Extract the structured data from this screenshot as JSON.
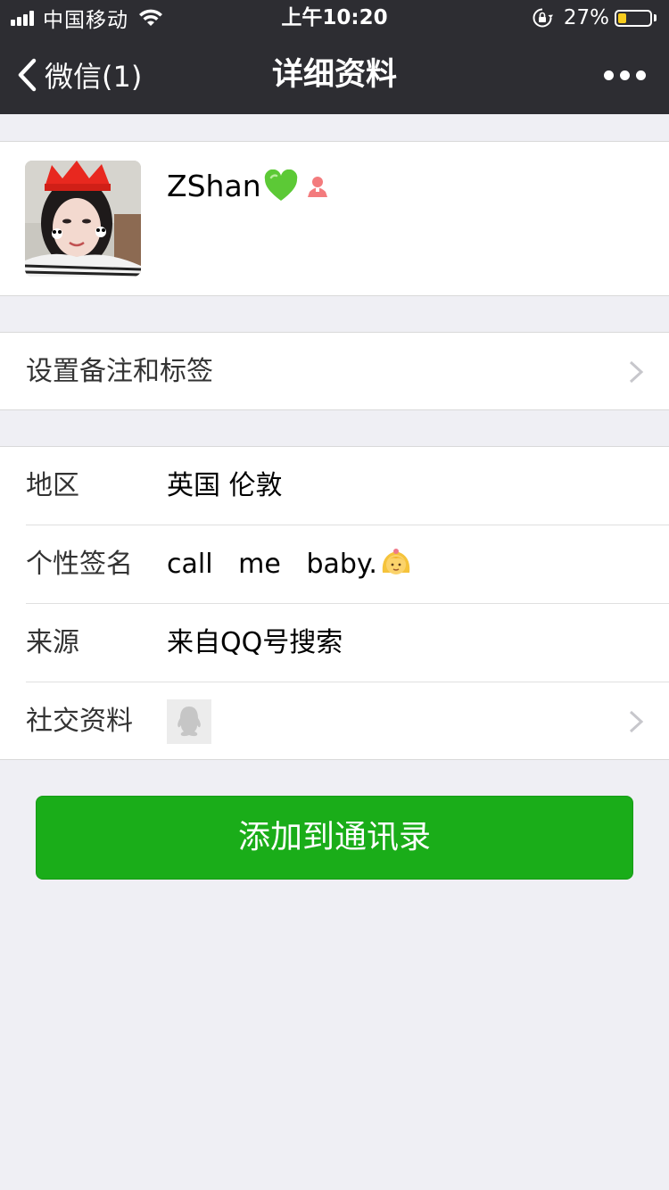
{
  "status_bar": {
    "carrier": "中国移动",
    "time": "上午10:20",
    "battery_percent_text": "27%",
    "battery_level": 0.27,
    "battery_color": "#f7cc1d"
  },
  "nav": {
    "back_label": "微信(1)",
    "title": "详细资料",
    "more_icon": "more-dots-icon"
  },
  "profile": {
    "name": "ZShan",
    "name_emoji": "green-heart-icon",
    "gender_icon": "female-icon",
    "gender_color": "#f37b7d"
  },
  "remark_row": {
    "label": "设置备注和标签"
  },
  "info_rows": {
    "region": {
      "label": "地区",
      "value": "英国 伦敦"
    },
    "signature": {
      "label": "个性签名",
      "value": "call   me   baby."
    },
    "source": {
      "label": "来源",
      "value": "来自QQ号搜索"
    },
    "social": {
      "label": "社交资料",
      "icon": "qq-icon"
    }
  },
  "add_button": {
    "label": "添加到通讯录",
    "color": "#1aad19"
  },
  "colors": {
    "nav_background": "#2d2d32",
    "page_background": "#efeff4"
  }
}
